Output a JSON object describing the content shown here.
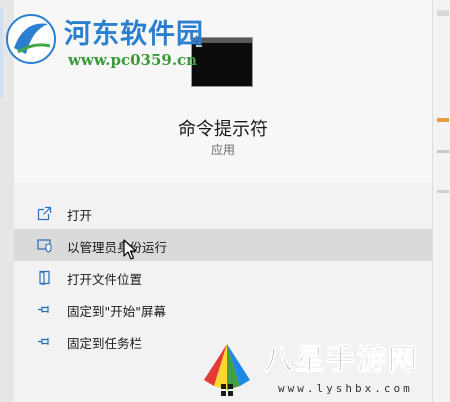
{
  "watermark_top": {
    "brand": "河东软件园",
    "site": "www.pc0359.cn"
  },
  "app": {
    "name": "命令提示符",
    "type": "应用",
    "icon": "command-prompt-icon"
  },
  "menu": {
    "items": [
      {
        "label": "打开",
        "icon": "open-icon"
      },
      {
        "label": "以管理员身份运行",
        "icon": "run-as-admin-icon"
      },
      {
        "label": "打开文件位置",
        "icon": "file-location-icon"
      },
      {
        "label": "固定到\"开始\"屏幕",
        "icon": "pin-icon"
      },
      {
        "label": "固定到任务栏",
        "icon": "pin-icon"
      }
    ],
    "hovered_index": 1
  },
  "watermark_bottom": {
    "brand": "八星手游网",
    "domain": "www.lyshbx.com"
  },
  "colors": {
    "accent": "#2b7fd0",
    "hover": "#dadada",
    "panel": "#f2f2f2"
  }
}
